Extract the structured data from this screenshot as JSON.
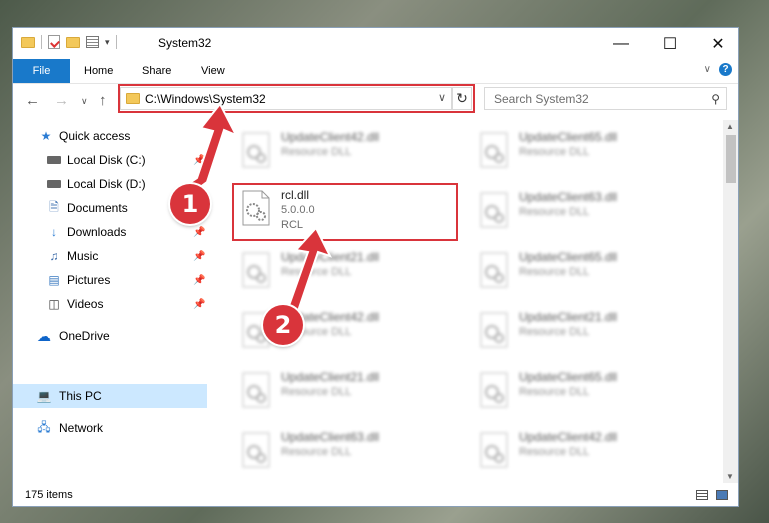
{
  "window": {
    "title": "System32",
    "min_icon": "minimize-icon",
    "max_icon": "maximize-icon",
    "close_icon": "close-icon"
  },
  "ribbon": {
    "tabs": [
      {
        "label": "File"
      },
      {
        "label": "Home"
      },
      {
        "label": "Share"
      },
      {
        "label": "View"
      }
    ]
  },
  "address": {
    "path": "C:\\Windows\\System32",
    "search_placeholder": "Search System32"
  },
  "sidebar": {
    "items": [
      {
        "label": "Quick access",
        "icon": "star-icon"
      },
      {
        "label": "Local Disk (C:)",
        "icon": "drive-icon"
      },
      {
        "label": "Local Disk (D:)",
        "icon": "drive-icon"
      },
      {
        "label": "Documents",
        "icon": "documents-icon"
      },
      {
        "label": "Downloads",
        "icon": "download-icon"
      },
      {
        "label": "Music",
        "icon": "music-icon"
      },
      {
        "label": "Pictures",
        "icon": "pictures-icon"
      },
      {
        "label": "Videos",
        "icon": "videos-icon"
      },
      {
        "label": "OneDrive",
        "icon": "cloud-icon"
      },
      {
        "label": "This PC",
        "icon": "computer-icon"
      },
      {
        "label": "Network",
        "icon": "network-icon"
      }
    ]
  },
  "files": {
    "highlighted": {
      "name": "rcl.dll",
      "version": "5.0.0.0",
      "desc": "RCL"
    },
    "left": [
      {
        "name": "UpdateClient42.dll",
        "desc": "Resource DLL"
      },
      {
        "name": "UpdateClient21.dll",
        "desc": "Resource DLL"
      },
      {
        "name": "UpdateClient42.dll",
        "desc": "Resource DLL"
      },
      {
        "name": "UpdateClient21.dll",
        "desc": "Resource DLL"
      },
      {
        "name": "UpdateClient63.dll",
        "desc": "Resource DLL"
      }
    ],
    "right": [
      {
        "name": "UpdateClient65.dll",
        "desc": "Resource DLL"
      },
      {
        "name": "UpdateClient63.dll",
        "desc": "Resource DLL"
      },
      {
        "name": "UpdateClient65.dll",
        "desc": "Resource DLL"
      },
      {
        "name": "UpdateClient21.dll",
        "desc": "Resource DLL"
      },
      {
        "name": "UpdateClient65.dll",
        "desc": "Resource DLL"
      },
      {
        "name": "UpdateClient42.dll",
        "desc": "Resource DLL"
      }
    ]
  },
  "status": {
    "items_count": "175 items"
  },
  "annotations": {
    "step1": "1",
    "step2": "2",
    "color": "#d9343b"
  }
}
